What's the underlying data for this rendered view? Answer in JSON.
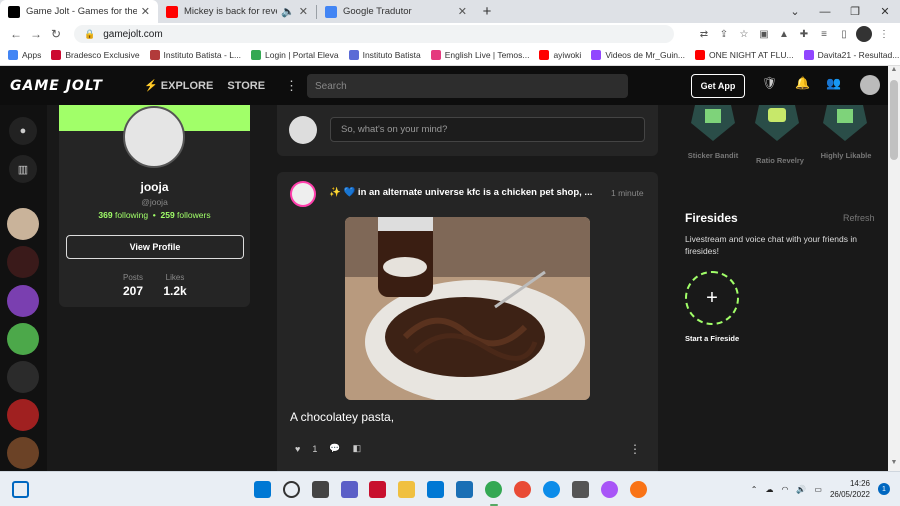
{
  "browser": {
    "tabs": [
      {
        "title": "Game Jolt - Games for the love o",
        "color": "#000000",
        "active": true
      },
      {
        "title": "Mickey is back for revenge! ",
        "color": "#ff0000",
        "active": false
      },
      {
        "title": "Google Tradutor",
        "color": "#4285f4",
        "active": false
      }
    ],
    "url": "gamejolt.com",
    "bookmarks": [
      {
        "label": "Apps",
        "color": "#4285f4"
      },
      {
        "label": "Bradesco Exclusive",
        "color": "#cc092f"
      },
      {
        "label": "Instituto Batista - L...",
        "color": "#b23b3b"
      },
      {
        "label": "Login | Portal Eleva",
        "color": "#34a853"
      },
      {
        "label": "Instituto Batista",
        "color": "#5b6bd6"
      },
      {
        "label": "English Live | Temos...",
        "color": "#e53a7e"
      },
      {
        "label": "ayiwoki",
        "color": "#ff0000"
      },
      {
        "label": "Videos de Mr_Guin...",
        "color": "#9146ff"
      },
      {
        "label": "ONE NIGHT AT FLU...",
        "color": "#ff0000"
      },
      {
        "label": "Davita21 - Resultad...",
        "color": "#9146ff"
      }
    ]
  },
  "gamejolt": {
    "logo": "GAME JOLT",
    "nav": {
      "explore": "EXPLORE",
      "store": "STORE"
    },
    "search_placeholder": "Search",
    "get_app": "Get App"
  },
  "profile": {
    "name": "jooja",
    "handle": "@jooja",
    "following_count": "369",
    "following_label": "following",
    "followers_count": "259",
    "followers_label": "followers",
    "view_profile": "View Profile",
    "posts_label": "Posts",
    "posts_value": "207",
    "likes_label": "Likes",
    "likes_value": "1.2k"
  },
  "composer": {
    "placeholder": "So, what's on your mind?"
  },
  "post": {
    "title": "✨ 💙 in an alternate universe kfc is a chicken pet shop, ...",
    "time": "1 minute",
    "caption": "A chocolatey pasta,",
    "likes": "1"
  },
  "trophies": [
    {
      "label": "Sticker Bandit",
      "color": "#2a4d48"
    },
    {
      "label": "Ratio Revelry",
      "color": "#2a4d48"
    },
    {
      "label": "Highly Likable",
      "color": "#2a4d48"
    }
  ],
  "firesides": {
    "title": "Firesides",
    "refresh": "Refresh",
    "description": "Livestream and voice chat with your friends in firesides!",
    "start": "Start a Fireside"
  },
  "taskbar": {
    "time": "14:26",
    "date": "26/05/2022",
    "notifications": "1"
  }
}
